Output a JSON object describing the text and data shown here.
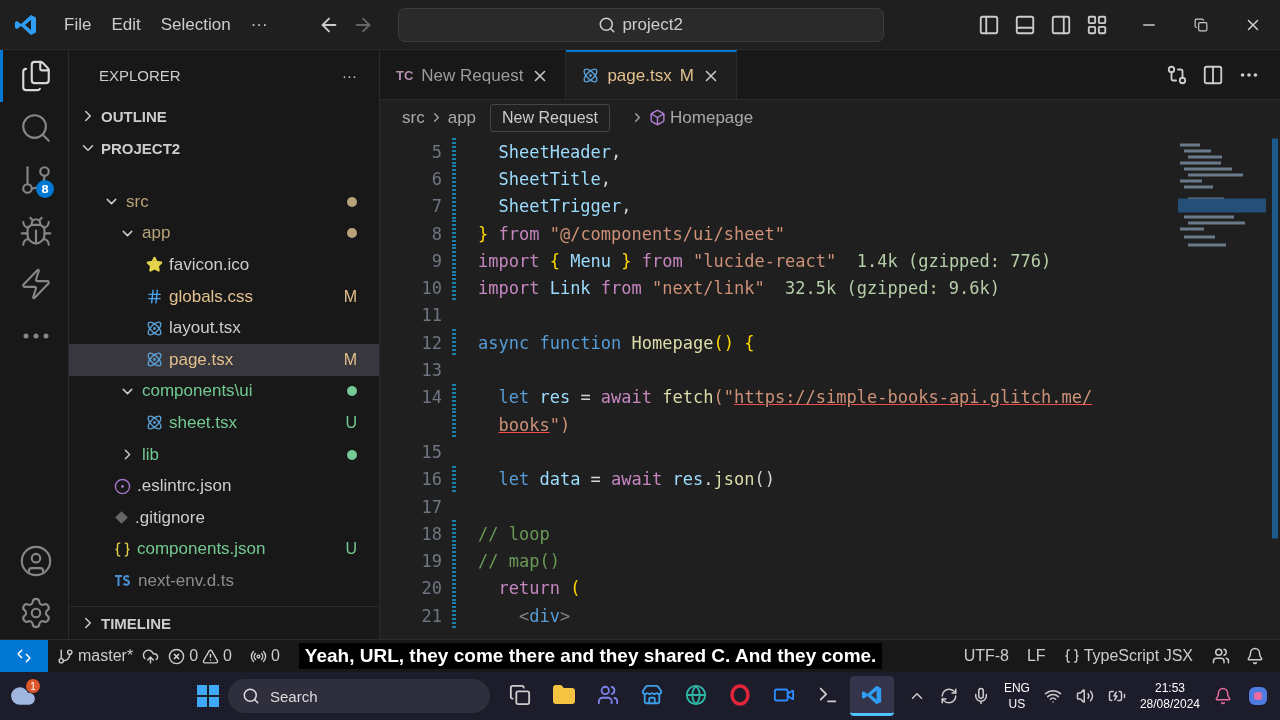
{
  "menu": [
    "File",
    "Edit",
    "Selection",
    "···"
  ],
  "command_center": {
    "value": "project2"
  },
  "activity_bar": [
    {
      "kind": "files",
      "selected": true
    },
    {
      "kind": "search",
      "selected": false
    },
    {
      "kind": "scm",
      "selected": false,
      "badge": "8"
    },
    {
      "kind": "debug",
      "selected": false
    },
    {
      "kind": "bolt",
      "selected": false
    },
    {
      "kind": "more",
      "selected": false
    }
  ],
  "activity_bottom": [
    {
      "kind": "account"
    },
    {
      "kind": "settings"
    }
  ],
  "sidebar": {
    "title": "EXPLORER",
    "more": "···",
    "sections": [
      {
        "label": "OUTLINE",
        "expanded": false
      },
      {
        "label": "PROJECT2",
        "expanded": true
      }
    ],
    "tree": [
      {
        "name": "src",
        "kind": "folder",
        "expanded": true,
        "color": "#b8a27a",
        "children": [
          {
            "name": "app",
            "kind": "folder",
            "expanded": true,
            "color": "#b8a27a",
            "children": [
              {
                "name": "favicon.ico",
                "kind": "star",
                "color": "#cccccc",
                "selected": false
              },
              {
                "name": "globals.css",
                "kind": "css",
                "color": "#e2c08d",
                "badge": "M",
                "selected": false
              },
              {
                "name": "layout.tsx",
                "kind": "react",
                "color": "#cccccc",
                "selected": false
              },
              {
                "name": "page.tsx",
                "kind": "react",
                "color": "#e2c08d",
                "badge": "M",
                "selected": true
              }
            ]
          },
          {
            "name": "components\\ui",
            "kind": "folder",
            "expanded": true,
            "color": "#73c991",
            "children": [
              {
                "name": "sheet.tsx",
                "kind": "react",
                "color": "#73c991",
                "badge": "U",
                "selected": false
              }
            ]
          },
          {
            "name": "lib",
            "kind": "folder",
            "expanded": false,
            "color": "#73c991"
          }
        ]
      },
      {
        "name": ".eslintrc.json",
        "kind": "eslint",
        "color": "#cccccc",
        "selected": false
      },
      {
        "name": ".gitignore",
        "kind": "git",
        "color": "#cccccc",
        "selected": false
      },
      {
        "name": "components.json",
        "kind": "json",
        "color": "#73c991",
        "badge": "U",
        "selected": false
      },
      {
        "name": "next-env.d.ts",
        "kind": "ts",
        "color": "#8c8c8c",
        "selected": false
      }
    ],
    "timeline": {
      "label": "TIMELINE",
      "expanded": false
    }
  },
  "tabs": [
    {
      "icon_text": "TC",
      "label": "New Request",
      "selected": false
    },
    {
      "label": "page.tsx",
      "badge": "M",
      "selected": true
    }
  ],
  "breadcrumbs": [
    "src",
    "app",
    "Homepage"
  ],
  "tooltip": "New Request",
  "code": [
    {
      "n": "5",
      "tokens": [
        {
          "text": "  SheetHeader",
          "kind": "var"
        },
        {
          "text": ",",
          "kind": "punct"
        }
      ]
    },
    {
      "n": "6",
      "tokens": [
        {
          "text": "  SheetTitle",
          "kind": "var"
        },
        {
          "text": ",",
          "kind": "punct"
        }
      ]
    },
    {
      "n": "7",
      "tokens": [
        {
          "text": "  SheetTrigger",
          "kind": "var"
        },
        {
          "text": ",",
          "kind": "punct"
        }
      ]
    },
    {
      "n": "8",
      "tokens": [
        {
          "text": "}",
          "kind": "brace"
        },
        {
          "text": " from ",
          "kind": "kw"
        },
        {
          "text": "\"@/components/ui/sheet\"",
          "kind": "str"
        }
      ]
    },
    {
      "n": "9",
      "tokens": [
        {
          "text": "import ",
          "kind": "kw"
        },
        {
          "text": "{",
          "kind": "brace"
        },
        {
          "text": " Menu ",
          "kind": "var"
        },
        {
          "text": "}",
          "kind": "brace"
        },
        {
          "text": " from ",
          "kind": "kw"
        },
        {
          "text": "\"lucide-react\"",
          "kind": "str"
        },
        {
          "text": "  1.4k (gzipped: 776)",
          "kind": "hint"
        }
      ]
    },
    {
      "n": "10",
      "tokens": [
        {
          "text": "import ",
          "kind": "kw"
        },
        {
          "text": "Link",
          "kind": "var"
        },
        {
          "text": " from ",
          "kind": "kw"
        },
        {
          "text": "\"next/link\"",
          "kind": "str"
        },
        {
          "text": "  32.5k (gzipped: 9.6k)",
          "kind": "hint"
        }
      ]
    },
    {
      "n": "11"
    },
    {
      "n": "12",
      "tokens": [
        {
          "text": "async ",
          "kind": "storage"
        },
        {
          "text": "function ",
          "kind": "storage"
        },
        {
          "text": "Homepage",
          "kind": "func"
        },
        {
          "text": "() {",
          "kind": "brace"
        }
      ]
    },
    {
      "n": "13"
    },
    {
      "n": "14",
      "tokens": [
        {
          "text": "  let ",
          "kind": "storage"
        },
        {
          "text": "res",
          "kind": "var"
        },
        {
          "text": " = ",
          "kind": "punct"
        },
        {
          "text": "await ",
          "kind": "kw"
        },
        {
          "text": "fetch",
          "kind": "func"
        },
        {
          "text": "(\"",
          "kind": "str"
        },
        {
          "text": "https://simple-books-api.glitch.me/",
          "kind": "link"
        }
      ]
    },
    {
      "tokens": [
        {
          "text": "books",
          "kind": "link"
        },
        {
          "text": "\")",
          "kind": "str"
        }
      ]
    },
    {
      "n": "15"
    },
    {
      "n": "16",
      "tokens": [
        {
          "text": "  let ",
          "kind": "storage"
        },
        {
          "text": "data",
          "kind": "var"
        },
        {
          "text": " = ",
          "kind": "punct"
        },
        {
          "text": "await ",
          "kind": "kw"
        },
        {
          "text": "res",
          "kind": "var"
        },
        {
          "text": ".",
          "kind": "punct"
        },
        {
          "text": "json",
          "kind": "func"
        },
        {
          "text": "()",
          "kind": "punct"
        }
      ]
    },
    {
      "n": "17"
    },
    {
      "n": "18",
      "tokens": [
        {
          "text": "// loop",
          "kind": "comment"
        }
      ]
    },
    {
      "n": "19",
      "tokens": [
        {
          "text": "// map()",
          "kind": "comment"
        }
      ]
    },
    {
      "n": "20",
      "tokens": [
        {
          "text": "  return ",
          "kind": "kw"
        },
        {
          "text": "(",
          "kind": "brace"
        }
      ]
    },
    {
      "n": "21",
      "tokens": [
        {
          "text": "    <",
          "kind": "tag"
        },
        {
          "text": "div",
          "kind": "storage"
        },
        {
          "text": ">",
          "kind": "tag"
        }
      ]
    }
  ],
  "status_bar": {
    "branch": "master*",
    "errors": "0",
    "warnings": "0",
    "ports": "0",
    "encoding": "UTF-8",
    "eol": "LF",
    "language": "TypeScript JSX"
  },
  "caption": "Yeah, URL, they come there and they shared C. And they come.",
  "taskbar": {
    "weather_badge": "1",
    "search": "Search",
    "apps": [
      {
        "kind": "taskview",
        "active": false
      },
      {
        "kind": "folder",
        "active": false
      },
      {
        "kind": "teams",
        "active": false
      },
      {
        "kind": "store",
        "active": false
      },
      {
        "kind": "edge",
        "active": false
      },
      {
        "kind": "opera",
        "active": false
      },
      {
        "kind": "zoom",
        "active": false
      },
      {
        "kind": "terminal",
        "active": false
      },
      {
        "kind": "vscode",
        "active": true
      }
    ],
    "lang": "ENG",
    "region": "US",
    "time": "21:53",
    "date": "28/08/2024"
  }
}
